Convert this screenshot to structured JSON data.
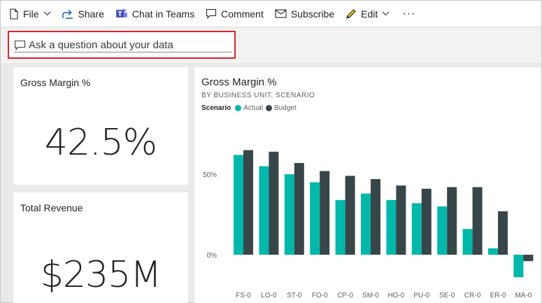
{
  "toolbar": {
    "file_label": "File",
    "share_label": "Share",
    "chat_label": "Chat in Teams",
    "comment_label": "Comment",
    "subscribe_label": "Subscribe",
    "edit_label": "Edit",
    "more_label": "···"
  },
  "qa": {
    "placeholder": "Ask a question about your data",
    "highlight_color": "#d7262f"
  },
  "tiles": {
    "gross_margin": {
      "title": "Gross Margin %",
      "value": "42.5%"
    },
    "total_revenue": {
      "title": "Total Revenue",
      "value": "$235M"
    }
  },
  "chart": {
    "title": "Gross Margin %",
    "subtitle": "BY BUSINESS UNIT, SCENARIO",
    "legend_title": "Scenario",
    "colors": {
      "actual": "#01b8aa",
      "budget": "#374649"
    }
  },
  "chart_data": {
    "type": "bar",
    "title": "Gross Margin %",
    "subtitle": "BY BUSINESS UNIT, SCENARIO",
    "categories": [
      "FS-0",
      "LO-0",
      "ST-0",
      "FO-0",
      "CP-0",
      "SM-0",
      "HO-0",
      "PU-0",
      "SE-0",
      "CR-0",
      "ER-0",
      "MA-0"
    ],
    "series": [
      {
        "name": "Actual",
        "color": "#01b8aa",
        "values": [
          62,
          55,
          50,
          45,
          34,
          38,
          34,
          32,
          30,
          16,
          4,
          -14
        ]
      },
      {
        "name": "Budget",
        "color": "#374649",
        "values": [
          65,
          64,
          57,
          52,
          49,
          47,
          43,
          41,
          42,
          42,
          27,
          -4
        ]
      }
    ],
    "yticks": [
      {
        "value": 0,
        "label": "0%"
      },
      {
        "value": 50,
        "label": "50%"
      }
    ],
    "ylim": [
      -16,
      80
    ],
    "legend": "top-left",
    "grid": false
  }
}
